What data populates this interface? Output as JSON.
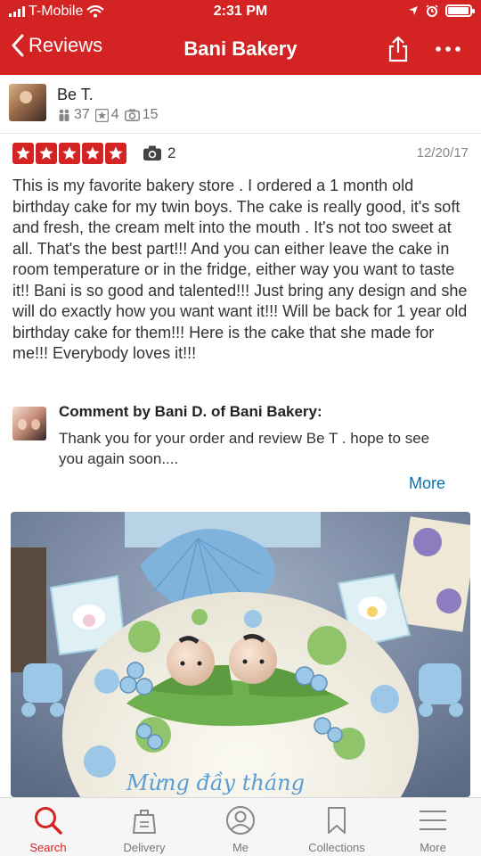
{
  "status_bar": {
    "carrier": "T-Mobile",
    "time": "2:31 PM",
    "battery_level": 0.95
  },
  "nav": {
    "back_label": "Reviews",
    "title": "Bani Bakery"
  },
  "user": {
    "name": "Be T.",
    "friends": "37",
    "reviews": "4",
    "photos": "15"
  },
  "review": {
    "rating": 5,
    "photo_count": "2",
    "date": "12/20/17",
    "text": "This is my favorite bakery store . I ordered a 1 month old birthday cake for my twin boys. The cake is really good, it's soft and fresh, the cream melt into the mouth . It's not too sweet at all. That's the best part!!! And you can either leave the cake in room temperature or in the fridge, either way you want to taste it!! Bani is so good and talented!!! Just bring any design and she will do exactly how you want want it!!! Will be back for 1 year old birthday cake for them!!!  Here is the cake that she made for me!!! Everybody loves it!!!"
  },
  "comment": {
    "title": "Comment by Bani D. of Bani Bakery:",
    "text": "Thank you for your order and review Be T . hope to see you again soon....",
    "more_label": "More"
  },
  "photo": {
    "cake_text": "Mừng đầy tháng"
  },
  "tabbar": {
    "items": [
      {
        "label": "Search",
        "icon": "search-icon",
        "active": true
      },
      {
        "label": "Delivery",
        "icon": "delivery-bag-icon",
        "active": false
      },
      {
        "label": "Me",
        "icon": "profile-icon",
        "active": false
      },
      {
        "label": "Collections",
        "icon": "bookmark-icon",
        "active": false
      },
      {
        "label": "More",
        "icon": "menu-icon",
        "active": false
      }
    ]
  },
  "colors": {
    "brand_red": "#d32323",
    "link_blue": "#0073bb",
    "muted": "#777777"
  }
}
